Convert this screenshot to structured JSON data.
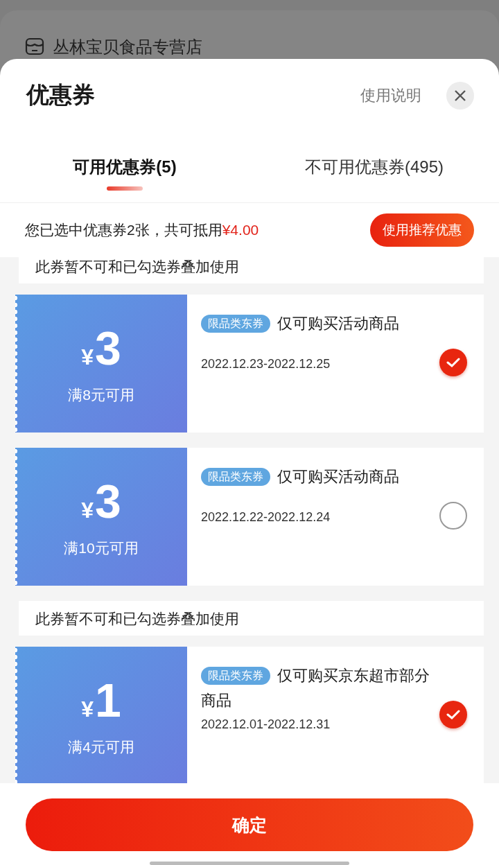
{
  "store": {
    "name": "丛林宝贝食品专营店"
  },
  "sheet": {
    "title": "优惠券",
    "help_link": "使用说明"
  },
  "tabs": [
    {
      "label": "可用优惠券(5)",
      "selected": true
    },
    {
      "label": "不可用优惠券(495)",
      "selected": false
    }
  ],
  "summary": {
    "text": "您已选中优惠券2张，共可抵用",
    "amount": "¥4.00",
    "button": "使用推荐优惠"
  },
  "items": [
    {
      "kind": "notice",
      "text": "此券暂不可和已勾选券叠加使用"
    },
    {
      "kind": "coupon",
      "currency": "¥",
      "amount": "3",
      "condition": "满8元可用",
      "tag": "限品类东券",
      "scope": "仅可购买活动商品",
      "validity": "2022.12.23-2022.12.25",
      "selected": true
    },
    {
      "kind": "coupon",
      "currency": "¥",
      "amount": "3",
      "condition": "满10元可用",
      "tag": "限品类东券",
      "scope": "仅可购买活动商品",
      "validity": "2022.12.22-2022.12.24",
      "selected": false
    },
    {
      "kind": "notice",
      "text": "此券暂不可和已勾选券叠加使用"
    },
    {
      "kind": "coupon",
      "currency": "¥",
      "amount": "1",
      "condition": "满4元可用",
      "tag": "限品类东券",
      "scope": "仅可购买京东超市部分商品",
      "validity": "2022.12.01-2022.12.31",
      "selected": true
    }
  ],
  "confirm_button": "确定"
}
